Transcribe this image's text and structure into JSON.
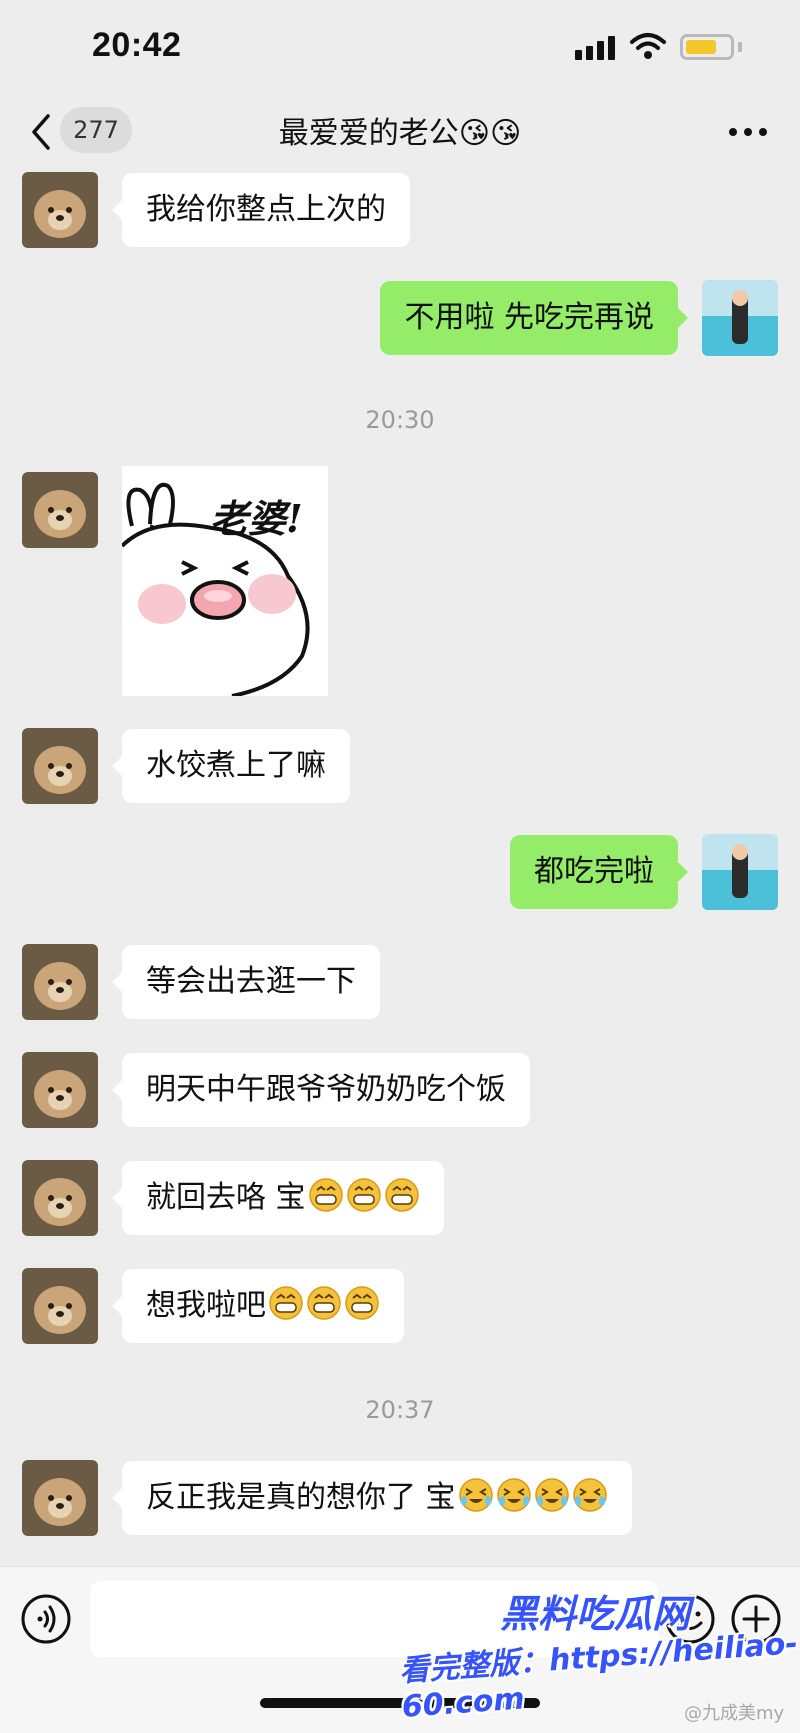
{
  "status_bar": {
    "time": "20:42",
    "battery_level": 0.75
  },
  "nav": {
    "unread_count": "277",
    "title": "最爱爱的老公😘😘"
  },
  "messages": [
    {
      "side": "in",
      "type": "text",
      "text": "我给你整点上次的"
    },
    {
      "side": "out",
      "type": "text",
      "text": "不用啦 先吃完再说"
    },
    {
      "type": "timestamp",
      "text": "20:30"
    },
    {
      "side": "in",
      "type": "sticker",
      "text": "老婆!"
    },
    {
      "side": "in",
      "type": "text",
      "text": "水饺煮上了嘛"
    },
    {
      "side": "out",
      "type": "text",
      "text": "都吃完啦"
    },
    {
      "side": "in",
      "type": "text",
      "text": "等会出去逛一下"
    },
    {
      "side": "in",
      "type": "text",
      "text": "明天中午跟爷爷奶奶吃个饭"
    },
    {
      "side": "in",
      "type": "text",
      "text": "就回去咯 宝",
      "emoji": "grin",
      "emoji_count": 3
    },
    {
      "side": "in",
      "type": "text",
      "text": "想我啦吧",
      "emoji": "grin",
      "emoji_count": 3
    },
    {
      "type": "timestamp",
      "text": "20:37"
    },
    {
      "side": "in",
      "type": "text",
      "text": "反正我是真的想你了 宝",
      "emoji": "tears-of-joy",
      "emoji_count": 4
    }
  ],
  "input": {
    "placeholder": ""
  },
  "icons": {
    "back": "chevron-left-icon",
    "more": "more-dots-icon",
    "voice": "voice-icon",
    "emoji": "emoji-icon",
    "plus": "plus-icon"
  },
  "watermark": {
    "brand": "黑料吃瓜网",
    "url": "看完整版：https://heiliao-60.com",
    "weibo": "@九成美my"
  },
  "colors": {
    "background": "#ededed",
    "incoming_bubble": "#ffffff",
    "outgoing_bubble": "#95ec69",
    "watermark": "#3553ff"
  }
}
